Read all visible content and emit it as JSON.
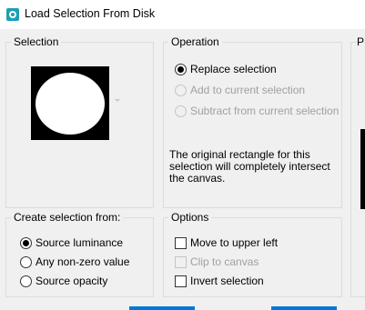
{
  "window": {
    "title": "Load Selection From Disk"
  },
  "selection_group": {
    "label": "Selection"
  },
  "operation_group": {
    "label": "Operation",
    "options": [
      {
        "label": "Replace selection",
        "checked": true,
        "enabled": true
      },
      {
        "label": "Add to current selection",
        "checked": false,
        "enabled": false
      },
      {
        "label": "Subtract from current selection",
        "checked": false,
        "enabled": false
      }
    ],
    "info": "The original rectangle for this selection will completely intersect the canvas."
  },
  "create_group": {
    "label": "Create selection from:",
    "options": [
      {
        "label": "Source luminance",
        "checked": true
      },
      {
        "label": "Any non-zero value",
        "checked": false
      },
      {
        "label": "Source opacity",
        "checked": false
      }
    ]
  },
  "options_group": {
    "label": "Options",
    "checks": [
      {
        "label": "Move to upper left",
        "checked": false,
        "enabled": true
      },
      {
        "label": "Clip to canvas",
        "checked": false,
        "enabled": false
      },
      {
        "label": "Invert selection",
        "checked": false,
        "enabled": true
      }
    ]
  },
  "right_panel": {
    "label": "P"
  },
  "colors": {
    "accent": "#0078d7",
    "app_icon": "#1a9fb5",
    "window_bg": "#f0f0f0"
  }
}
